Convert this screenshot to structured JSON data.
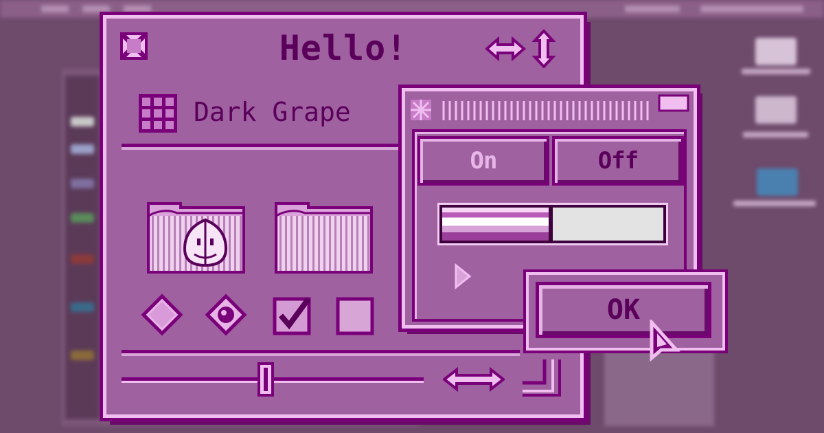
{
  "window": {
    "title": "Hello!",
    "theme_name": "Dark Grape"
  },
  "icons": {
    "close": "close-box-icon",
    "resize": "resize-arrows-icon",
    "theme": "grid-icon",
    "folder_finder": "finder-folder-icon",
    "folder_empty": "folder-icon",
    "cursor": "arrow-cursor-icon"
  },
  "controls": {
    "radio_1_checked": false,
    "radio_2_checked": true,
    "checkbox_1_checked": true,
    "checkbox_2_checked": false,
    "slider_value_fraction": 0.5
  },
  "inner_window": {
    "segment_on_label": "On",
    "segment_off_label": "Off",
    "selected_segment": "Off",
    "progress_fraction": 0.5
  },
  "dialog": {
    "ok_label": "OK"
  },
  "colors": {
    "window_bg": "#a061a0",
    "highlight": "#f0bff0",
    "outline": "#7a007a",
    "text": "#5a005a"
  }
}
